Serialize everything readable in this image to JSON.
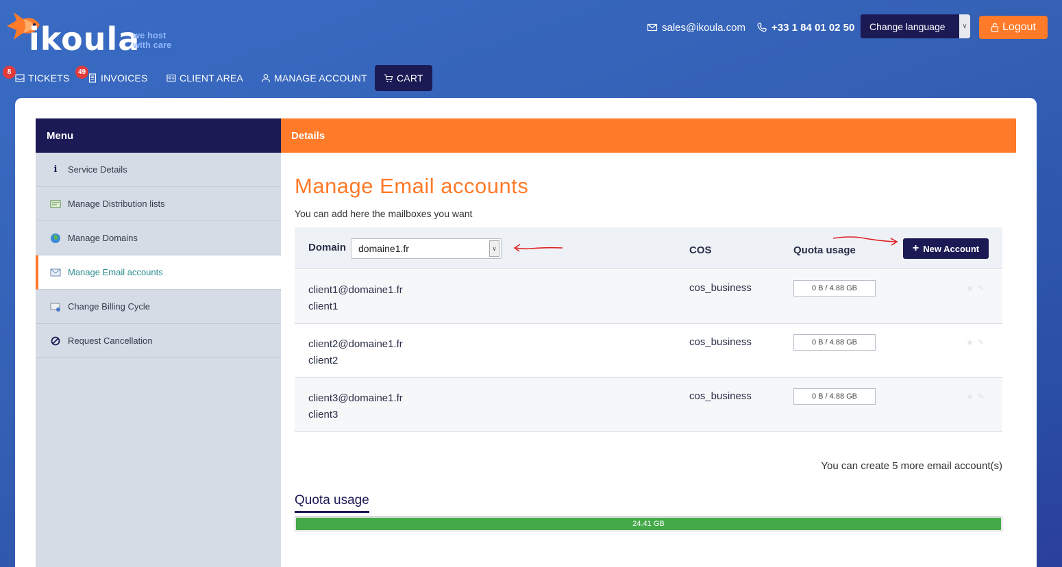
{
  "brand": {
    "name": "ikoula",
    "tagline_1": "we host",
    "tagline_2": "with care"
  },
  "header": {
    "email": "sales@ikoula.com",
    "phone": "+33 1 84 01 02 50",
    "language_label": "Change language",
    "logout_label": "Logout"
  },
  "nav": {
    "tickets": {
      "label": "TICKETS",
      "badge": "8"
    },
    "invoices": {
      "label": "INVOICES",
      "badge": "49"
    },
    "client_area": {
      "label": "CLIENT AREA"
    },
    "manage_account": {
      "label": "MANAGE ACCOUNT"
    },
    "cart": {
      "label": "CART"
    }
  },
  "menu": {
    "title": "Menu",
    "items": [
      {
        "label": "Service Details",
        "icon": "info-icon"
      },
      {
        "label": "Manage Distribution lists",
        "icon": "distribution-list-icon"
      },
      {
        "label": "Manage Domains",
        "icon": "globe-icon"
      },
      {
        "label": "Manage Email accounts",
        "icon": "email-accounts-icon",
        "active": true
      },
      {
        "label": "Change Billing Cycle",
        "icon": "billing-cycle-icon"
      },
      {
        "label": "Request Cancellation",
        "icon": "cancel-icon"
      }
    ]
  },
  "details": {
    "title": "Details",
    "page_title": "Manage Email accounts",
    "subtitle": "You can add here the mailboxes you want",
    "table": {
      "domain_label": "Domain",
      "domain_value": "domaine1.fr",
      "cos_label": "COS",
      "quota_label": "Quota usage",
      "new_account_label": "New Account",
      "rows": [
        {
          "email": "client1@domaine1.fr",
          "name": "client1",
          "cos": "cos_business",
          "quota": "0 B / 4.88 GB"
        },
        {
          "email": "client2@domaine1.fr",
          "name": "client2",
          "cos": "cos_business",
          "quota": "0 B / 4.88 GB"
        },
        {
          "email": "client3@domaine1.fr",
          "name": "client3",
          "cos": "cos_business",
          "quota": "0 B / 4.88 GB"
        }
      ]
    },
    "remaining_text": "You can create 5 more email account(s)",
    "quota_section_title": "Quota usage",
    "quota_bar_label": "24.41 GB",
    "quota_bar_fill_percent": 100
  },
  "colors": {
    "navy": "#1b1a55",
    "orange": "#ff7a29",
    "green": "#44a948",
    "teal_active": "#2b8b8f",
    "badge_red": "#e23b3b"
  }
}
